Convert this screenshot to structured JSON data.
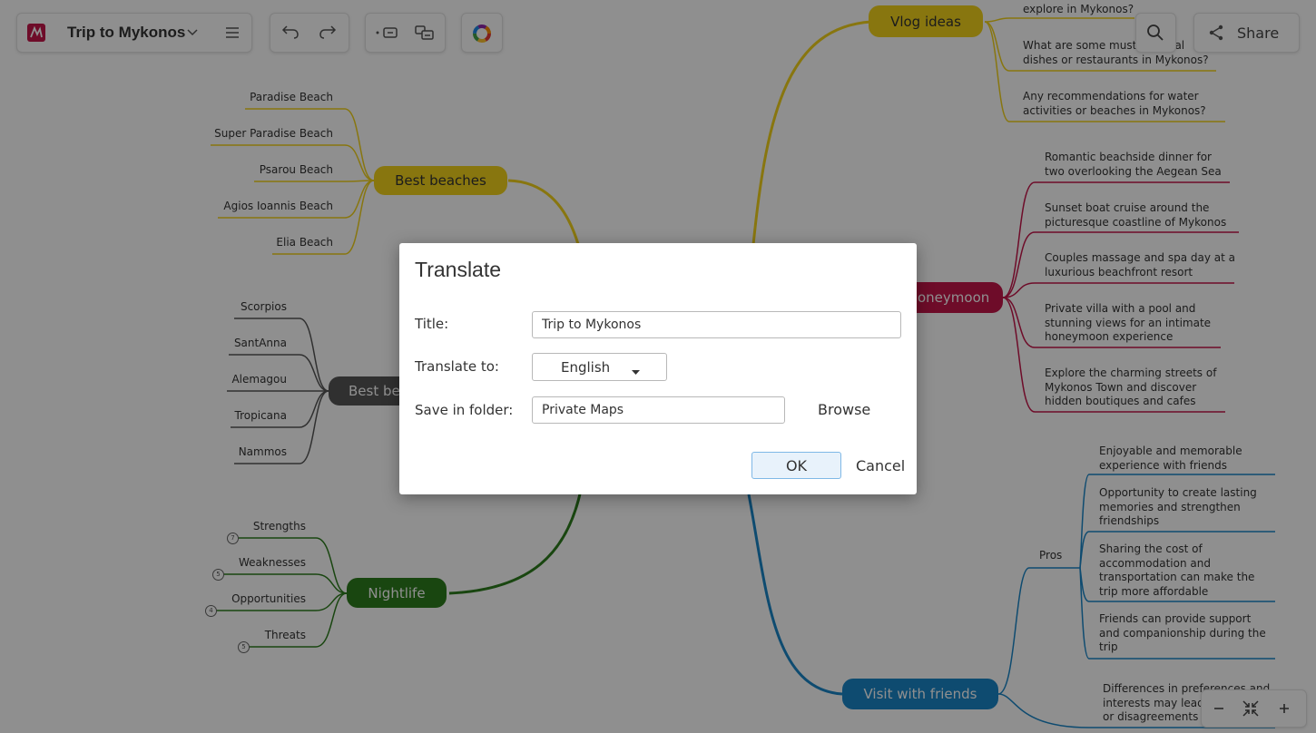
{
  "app": {
    "title": "Trip to Mykonos",
    "share_label": "Share"
  },
  "map": {
    "best_beaches": {
      "label": "Best beaches",
      "children": [
        "Paradise Beach",
        "Super Paradise Beach",
        "Psarou Beach",
        "Agios Ioannis Beach",
        "Elia Beach"
      ]
    },
    "best_bars": {
      "label": "Best be",
      "children": [
        "Scorpios",
        "SantAnna",
        "Alemagou",
        "Tropicana",
        "Nammos"
      ]
    },
    "nightlife": {
      "label": "Nightlife",
      "children": [
        "Strengths",
        "Weaknesses",
        "Opportunities",
        "Threats"
      ],
      "counts": [
        "7",
        "5",
        "4",
        "5"
      ]
    },
    "vlog_ideas": {
      "label": "Vlog ideas",
      "children": [
        "explore in Mykonos?",
        "What are some must-try local dishes or restaurants in Mykonos?",
        "Any recommendations for water activities or beaches in Mykonos?"
      ]
    },
    "honeymoon": {
      "label": "Honeymoon",
      "children": [
        "Romantic beachside dinner for two overlooking the Aegean Sea",
        "Sunset boat cruise around the picturesque coastline of Mykonos",
        "Couples massage and spa day at a luxurious beachfront resort",
        "Private villa with a pool and stunning views for an intimate honeymoon experience",
        "Explore the charming streets of Mykonos Town and discover hidden boutiques and cafes"
      ]
    },
    "visit_with_friends": {
      "label": "Visit with friends",
      "pros_label": "Pros",
      "pros": [
        "Enjoyable and memorable experience with friends",
        "Opportunity to create lasting memories and strengthen friendships",
        "Sharing the cost of accommodation and transportation can make the trip more affordable",
        "Friends can provide support and companionship during the trip"
      ],
      "cons": [
        "Differences in preferences and interests may lead to conflicts or disagreements"
      ]
    }
  },
  "colors": {
    "beaches": "#f2d21b",
    "bars": "#575757",
    "nightlife": "#2e7d1e",
    "honeymoon": "#c4164a",
    "friends": "#1a86c8"
  },
  "dialog": {
    "title": "Translate",
    "title_label": "Title:",
    "title_value": "Trip to Mykonos",
    "translate_label": "Translate to:",
    "language": "English",
    "folder_label": "Save in folder:",
    "folder_value": "Private Maps",
    "browse": "Browse",
    "ok": "OK",
    "cancel": "Cancel"
  }
}
